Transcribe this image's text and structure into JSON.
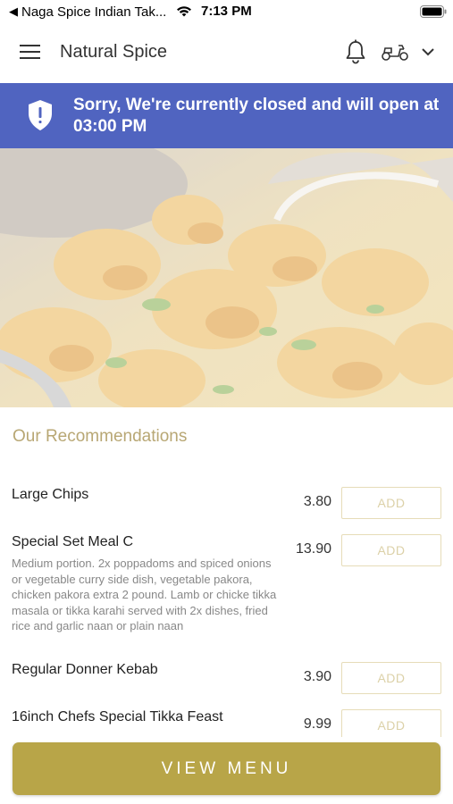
{
  "status_bar": {
    "back_glyph": "◀",
    "app_name": "Naga Spice Indian Tak...",
    "time": "7:13 PM",
    "wifi_icon": "wifi-icon",
    "battery_icon": "battery-icon"
  },
  "header": {
    "title": "Natural Spice",
    "icons": [
      "menu-icon",
      "bell-icon",
      "scooter-icon",
      "chevron-down-icon"
    ]
  },
  "banner": {
    "text": "Sorry, We're currently closed and will open at 03:00 PM",
    "icon": "shield-alert-icon",
    "color": "#5064c0"
  },
  "recommendations": {
    "title": "Our Recommendations",
    "items": [
      {
        "name": "Large Chips",
        "price": "3.80",
        "add_label": "ADD"
      },
      {
        "name": "Special Set Meal C",
        "price": "13.90",
        "description": "Medium portion. 2x poppadoms and spiced onions or vegetable curry side dish, vegetable pakora, chicken pakora extra 2 pound. Lamb or chicke tikka masala or tikka karahi served with 2x dishes, fried rice and garlic naan or plain naan",
        "add_label": "ADD"
      },
      {
        "name": "Regular Donner Kebab",
        "price": "3.90",
        "add_label": "ADD"
      },
      {
        "name": "16inch Chefs Special Tikka Feast",
        "price": "9.99",
        "add_label": "ADD"
      }
    ]
  },
  "view_menu": {
    "label": "VIEW MENU",
    "color": "#b8a548"
  },
  "colors": {
    "accent": "#b8a548",
    "heading": "#b8a774",
    "banner": "#5064c0"
  }
}
